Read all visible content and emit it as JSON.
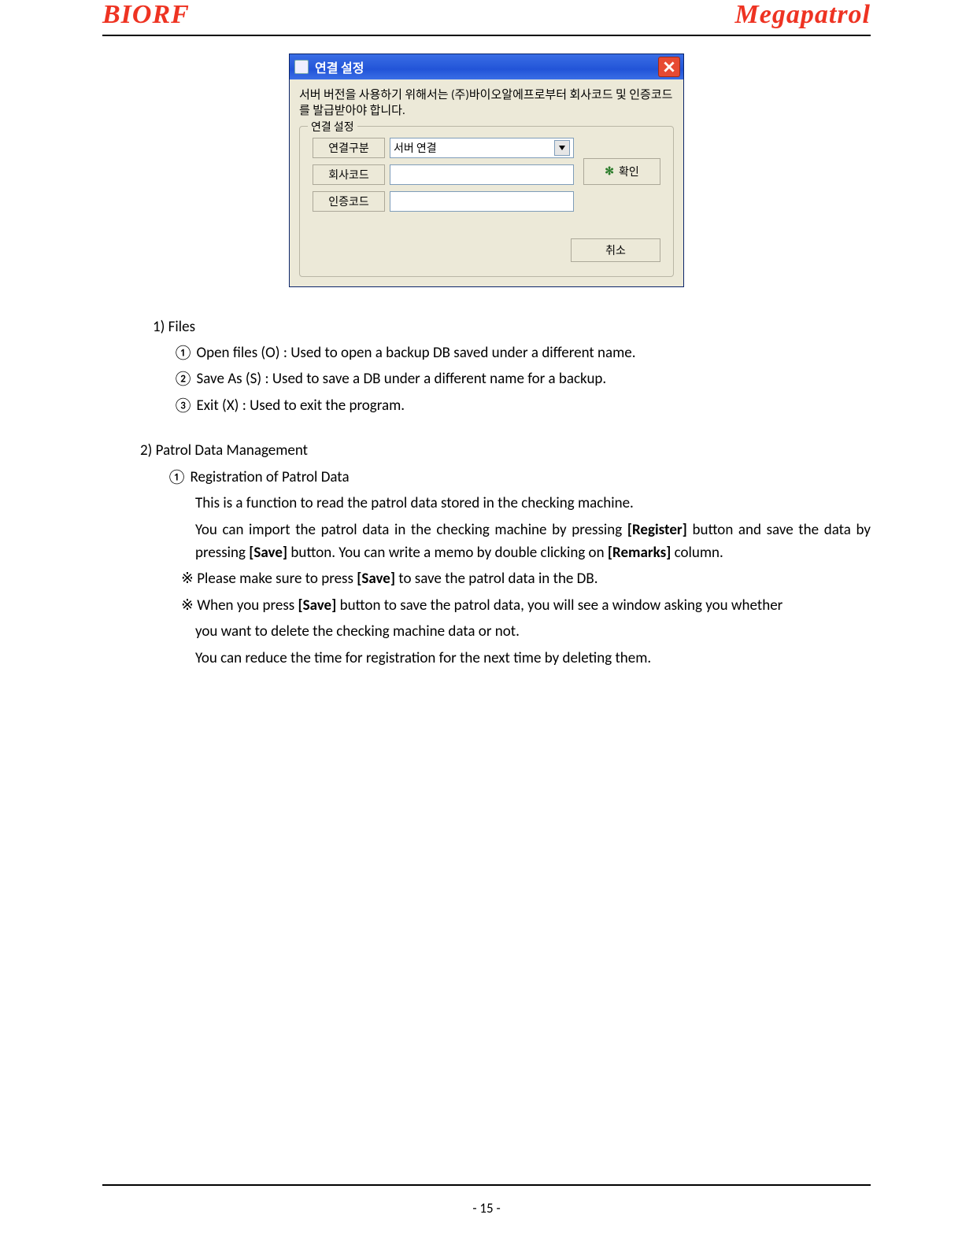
{
  "header": {
    "left": "BIORF",
    "right": "Megapatrol"
  },
  "dialog": {
    "title": "연결 설정",
    "message": "서버 버전을 사용하기 위해서는 (주)바이오알에프로부터 회사코드 및 인증코드를 발급받아야 합니다.",
    "legend": "연결 설정",
    "row1_label": "연결구분",
    "row1_value": "서버 연결",
    "row2_label": "회사코드",
    "row3_label": "인증코드",
    "ok": "확인",
    "cancel": "취소"
  },
  "sec1": {
    "heading": "1)  Files",
    "i1": "① Open files (O) : Used to open a backup DB saved under a different name.",
    "i2": "② Save As (S) : Used to save a DB under a different name for a backup.",
    "i3": "③ Exit (X) : Used to exit the program."
  },
  "sec2": {
    "heading": "2) Patrol Data Management",
    "i1": "① Registration of Patrol Data",
    "p1": "This is a function to read the patrol data stored in the checking machine.",
    "p2a": "You can import the patrol data in the checking machine by pressing ",
    "p2b": "[Register]",
    "p2c": " button and save the data by pressing ",
    "p2d": "[Save]",
    "p2e": " button. You can write a memo by double clicking on ",
    "p2f": "[Remarks]",
    "p2g": " column.",
    "n1a": "※ Please make sure to press ",
    "n1b": "[Save]",
    "n1c": " to save the patrol data in the DB.",
    "n2a": "※ When you press ",
    "n2b": "[Save]",
    "n2c": " button to save the patrol data, you will see a window asking you whether",
    "n2d": "you want to delete the checking machine data or not.",
    "n2e": "You can reduce the time for registration for the next time by deleting them."
  },
  "footer": {
    "page": "- 15 -"
  }
}
